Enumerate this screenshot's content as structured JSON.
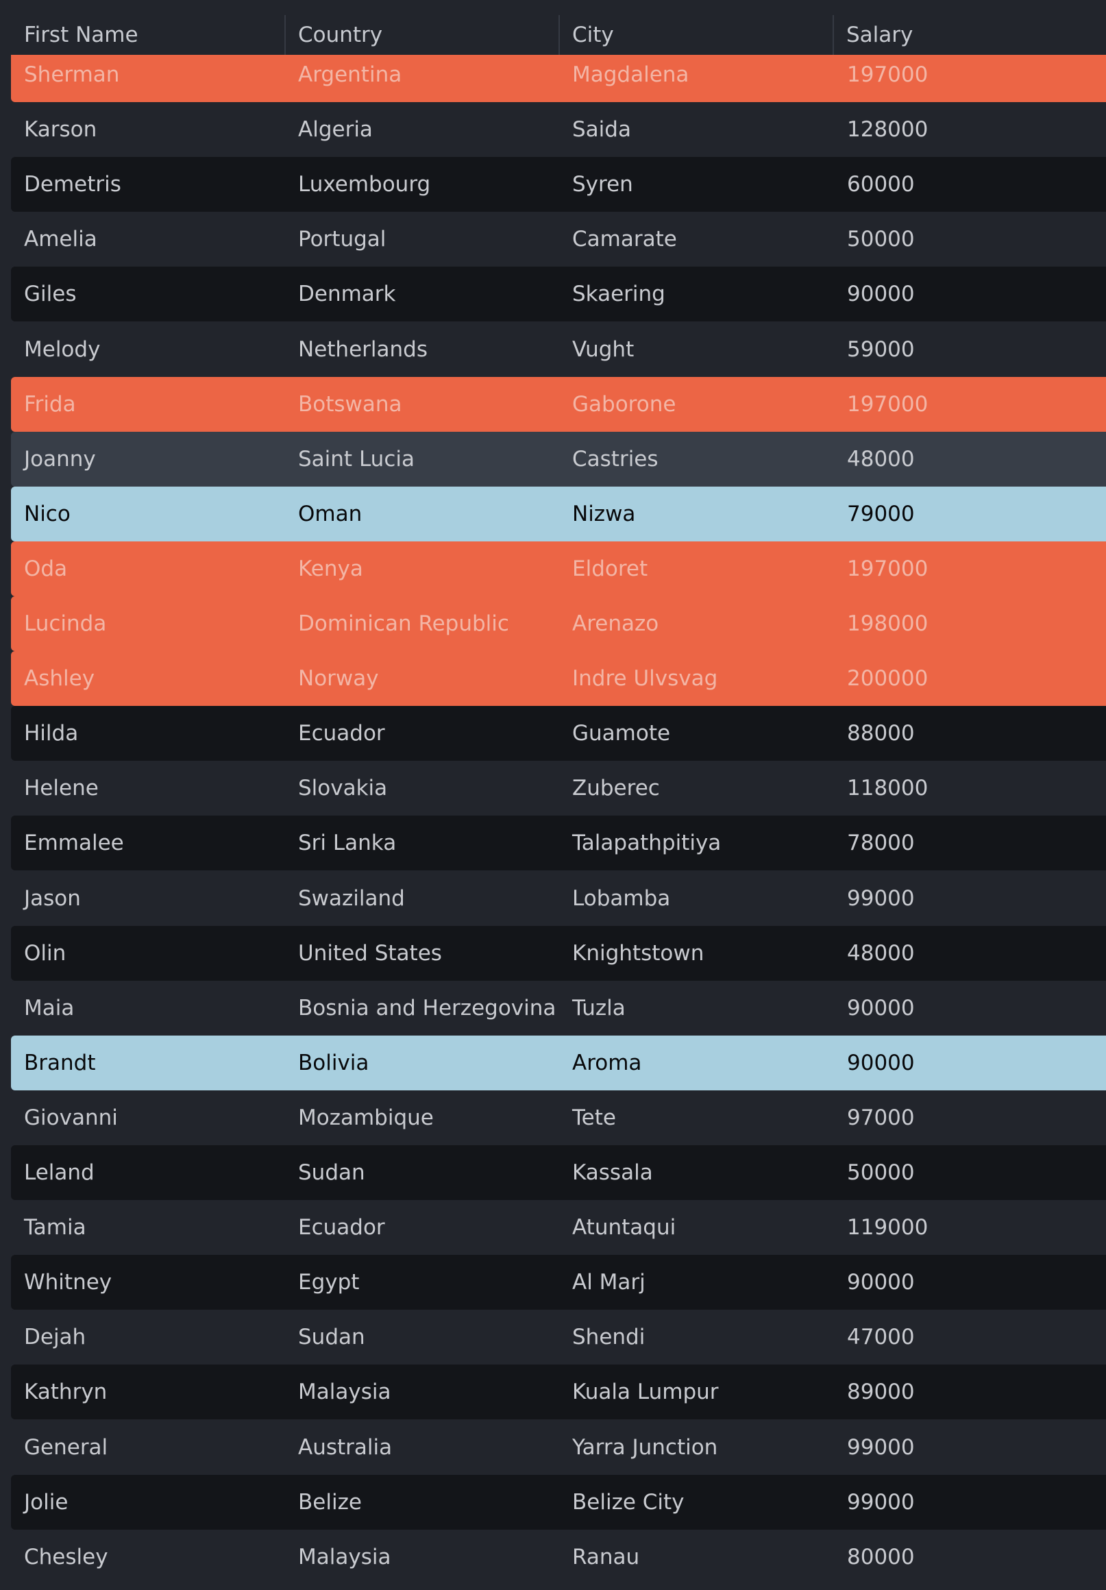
{
  "columns": [
    "First Name",
    "Country",
    "City",
    "Salary"
  ],
  "colors": {
    "header_bg": "#22252c",
    "row_dark": "#131519",
    "row_mid": "#22252c",
    "row_hover": "#383e48",
    "danger": "#ec6545",
    "selected": "#a8cfdf"
  },
  "rows": [
    {
      "first_name": "Sherman",
      "country": "Argentina",
      "city": "Magdalena",
      "salary": "197000",
      "style": "danger"
    },
    {
      "first_name": "Karson",
      "country": "Algeria",
      "city": "Saida",
      "salary": "128000",
      "style": "mid"
    },
    {
      "first_name": "Demetris",
      "country": "Luxembourg",
      "city": "Syren",
      "salary": "60000",
      "style": "dark"
    },
    {
      "first_name": "Amelia",
      "country": "Portugal",
      "city": "Camarate",
      "salary": "50000",
      "style": "mid"
    },
    {
      "first_name": "Giles",
      "country": "Denmark",
      "city": "Skaering",
      "salary": "90000",
      "style": "dark"
    },
    {
      "first_name": "Melody",
      "country": "Netherlands",
      "city": "Vught",
      "salary": "59000",
      "style": "mid"
    },
    {
      "first_name": "Frida",
      "country": "Botswana",
      "city": "Gaborone",
      "salary": "197000",
      "style": "danger"
    },
    {
      "first_name": "Joanny",
      "country": "Saint Lucia",
      "city": "Castries",
      "salary": "48000",
      "style": "slate"
    },
    {
      "first_name": "Nico",
      "country": "Oman",
      "city": "Nizwa",
      "salary": "79000",
      "style": "selected"
    },
    {
      "first_name": "Oda",
      "country": "Kenya",
      "city": "Eldoret",
      "salary": "197000",
      "style": "danger"
    },
    {
      "first_name": "Lucinda",
      "country": "Dominican Republic",
      "city": "Arenazo",
      "salary": "198000",
      "style": "danger"
    },
    {
      "first_name": "Ashley",
      "country": "Norway",
      "city": "Indre Ulvsvag",
      "salary": "200000",
      "style": "danger"
    },
    {
      "first_name": "Hilda",
      "country": "Ecuador",
      "city": "Guamote",
      "salary": "88000",
      "style": "dark"
    },
    {
      "first_name": "Helene",
      "country": "Slovakia",
      "city": "Zuberec",
      "salary": "118000",
      "style": "mid"
    },
    {
      "first_name": "Emmalee",
      "country": "Sri Lanka",
      "city": "Talapathpitiya",
      "salary": "78000",
      "style": "dark"
    },
    {
      "first_name": "Jason",
      "country": "Swaziland",
      "city": "Lobamba",
      "salary": "99000",
      "style": "mid"
    },
    {
      "first_name": "Olin",
      "country": "United States",
      "city": "Knightstown",
      "salary": "48000",
      "style": "dark"
    },
    {
      "first_name": "Maia",
      "country": "Bosnia and Herzegovina",
      "city": "Tuzla",
      "salary": "90000",
      "style": "mid"
    },
    {
      "first_name": "Brandt",
      "country": "Bolivia",
      "city": "Aroma",
      "salary": "90000",
      "style": "selected"
    },
    {
      "first_name": "Giovanni",
      "country": "Mozambique",
      "city": "Tete",
      "salary": "97000",
      "style": "mid"
    },
    {
      "first_name": "Leland",
      "country": "Sudan",
      "city": "Kassala",
      "salary": "50000",
      "style": "dark"
    },
    {
      "first_name": "Tamia",
      "country": "Ecuador",
      "city": "Atuntaqui",
      "salary": "119000",
      "style": "mid"
    },
    {
      "first_name": "Whitney",
      "country": "Egypt",
      "city": "Al Marj",
      "salary": "90000",
      "style": "dark"
    },
    {
      "first_name": "Dejah",
      "country": "Sudan",
      "city": "Shendi",
      "salary": "47000",
      "style": "mid"
    },
    {
      "first_name": "Kathryn",
      "country": "Malaysia",
      "city": "Kuala Lumpur",
      "salary": "89000",
      "style": "dark"
    },
    {
      "first_name": "General",
      "country": "Australia",
      "city": "Yarra Junction",
      "salary": "99000",
      "style": "mid"
    },
    {
      "first_name": "Jolie",
      "country": "Belize",
      "city": "Belize City",
      "salary": "99000",
      "style": "dark"
    },
    {
      "first_name": "Chesley",
      "country": "Malaysia",
      "city": "Ranau",
      "salary": "80000",
      "style": "mid"
    }
  ]
}
